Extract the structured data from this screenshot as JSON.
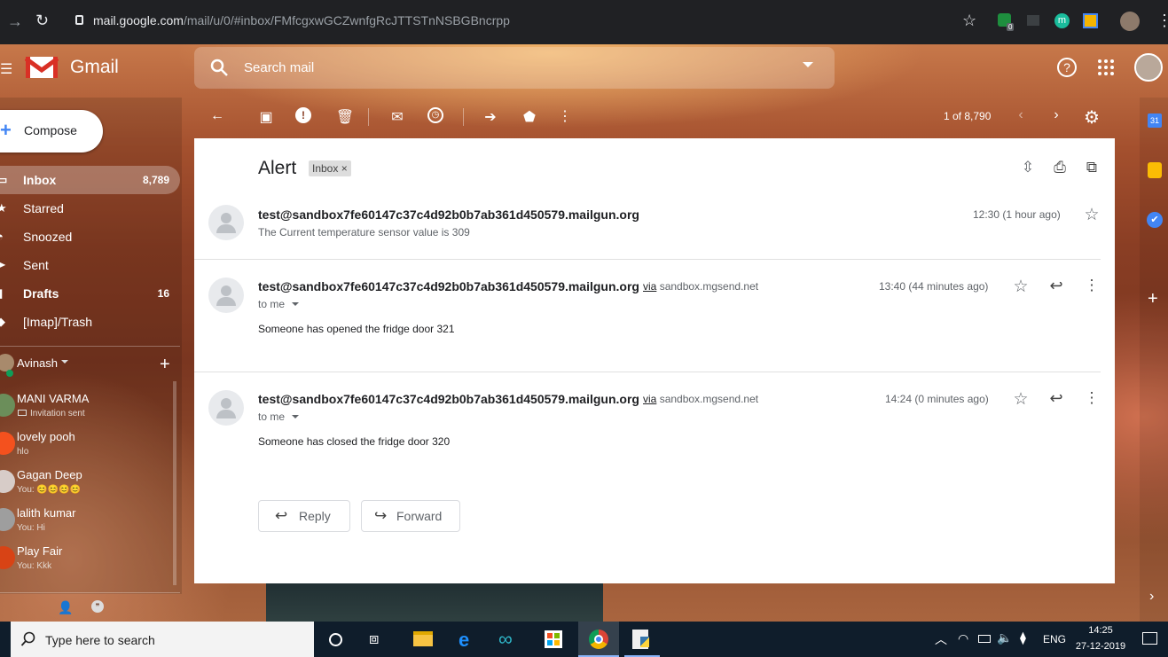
{
  "browser": {
    "url_host": "mail.google.com",
    "url_path": "/mail/u/0/#inbox/FMfcgxwGCZwnfgRcJTTSTnNSBGBncrpp",
    "extension_badge": "0",
    "ext_m": "m"
  },
  "header": {
    "brand": "Gmail",
    "search_placeholder": "Search mail"
  },
  "sidebar": {
    "compose_label": "Compose",
    "items": [
      {
        "label": "Inbox",
        "count": "8,789"
      },
      {
        "label": "Starred",
        "count": ""
      },
      {
        "label": "Snoozed",
        "count": ""
      },
      {
        "label": "Sent",
        "count": ""
      },
      {
        "label": "Drafts",
        "count": "16"
      },
      {
        "label": "[Imap]/Trash",
        "count": ""
      }
    ]
  },
  "hangouts": {
    "user": "Avinash",
    "contacts": [
      {
        "name": "MANI VARMA",
        "sub": "Invitation sent"
      },
      {
        "name": "lovely pooh",
        "sub": "hlo"
      },
      {
        "name": "Gagan Deep",
        "sub": "You: 😊😊😊😊"
      },
      {
        "name": "lalith kumar",
        "sub": "You: Hi"
      },
      {
        "name": "Play Fair",
        "sub": "You: Kkk"
      }
    ]
  },
  "toolbar": {
    "pagination": "1 of 8,790"
  },
  "thread": {
    "subject": "Alert",
    "label_tag": "Inbox",
    "messages": [
      {
        "sender": "test@sandbox7fe60147c37c4d92b0b7ab361d450579.mailgun.org",
        "via_word": "",
        "via_domain": "",
        "time": "12:30 (1 hour ago)",
        "snippet": "The Current temperature sensor value is 309",
        "to": "",
        "body": ""
      },
      {
        "sender": "test@sandbox7fe60147c37c4d92b0b7ab361d450579.mailgun.org",
        "via_word": "via",
        "via_domain": "sandbox.mgsend.net",
        "time": "13:40 (44 minutes ago)",
        "snippet": "",
        "to": "to me",
        "body": "Someone has opened the fridge door 321"
      },
      {
        "sender": "test@sandbox7fe60147c37c4d92b0b7ab361d450579.mailgun.org",
        "via_word": "via",
        "via_domain": "sandbox.mgsend.net",
        "time": "14:24 (0 minutes ago)",
        "snippet": "",
        "to": "to me",
        "body": "Someone has closed the fridge door 320"
      }
    ],
    "reply_label": "Reply",
    "forward_label": "Forward"
  },
  "right_panel": {
    "calendar_day": "31"
  },
  "taskbar": {
    "search_placeholder": "Type here to search",
    "language": "ENG",
    "time": "14:25",
    "date": "27-12-2019"
  }
}
